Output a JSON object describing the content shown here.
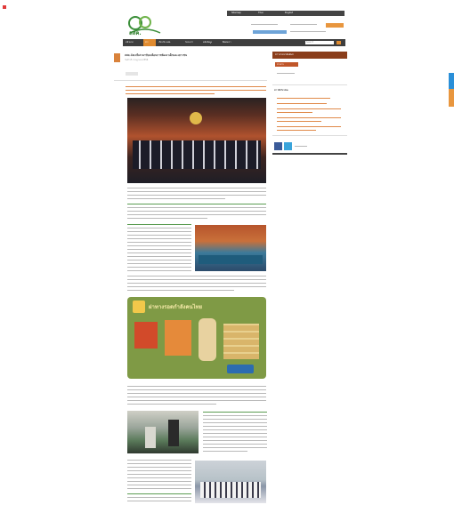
{
  "header": {
    "logo_text": "สสค.",
    "top_links": [
      "Sitemap",
      "Thai",
      "English"
    ],
    "search_placeholder": "Search"
  },
  "nav": {
    "items": [
      "หน้าแรก",
      "ข่าว",
      "เกี่ยวกับ สสค.",
      "โครงการ",
      "คลังข้อมูล",
      "ติดต่อเรา"
    ]
  },
  "article": {
    "title": "สสค.จัดเวทีเสวนาขับเคลื่อนการพัฒนาเด็กและเยาวชน",
    "date": "วันที่ 15 กรกฎาคม 2556",
    "infographic": {
      "title": "ผ่าทางรอดกำลังคนไทย"
    }
  },
  "sidebar": {
    "section_title": "ข่าวประชาสัมพันธ์",
    "tab_label": "ข่าวสาร",
    "related_title": "ข่าวที่เกี่ยวข้อง"
  },
  "colors": {
    "accent": "#d9823b",
    "nav_bg": "#3e3e3e",
    "logo_green": "#3c8f3a",
    "sidebar_header": "#8a3d1a",
    "side_tab": "#2a8fd8"
  }
}
